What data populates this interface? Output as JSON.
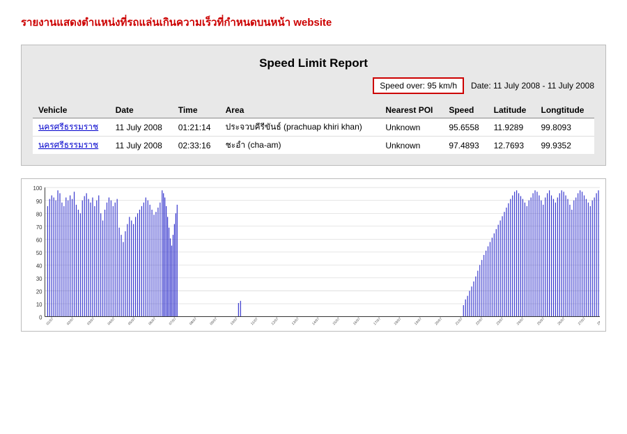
{
  "page": {
    "title": "รายงานแสดงตำแหน่งที่รถแล่นเกินความเร็วที่กำหนดบนหน้า website"
  },
  "report": {
    "title": "Speed Limit Report",
    "speed_over_label": "Speed over: 95 km/h",
    "date_label": "Date: 11 July 2008 - 11 July 2008",
    "table": {
      "headers": [
        "Vehicle",
        "Date",
        "Time",
        "Area",
        "Nearest POI",
        "Speed",
        "Latitude",
        "Longtitude"
      ],
      "rows": [
        {
          "vehicle": "นครศรีธรรมราช",
          "date": "11 July 2008",
          "time": "01:21:14",
          "area": "ประจวบคีรีขันธ์ (prachuap khiri khan)",
          "nearest_poi": "Unknown",
          "speed": "95.6558",
          "latitude": "11.9289",
          "longitude": "99.8093"
        },
        {
          "vehicle": "นครศรีธรรมราช",
          "date": "11 July 2008",
          "time": "02:33:16",
          "area": "ชะอำ (cha-am)",
          "nearest_poi": "Unknown",
          "speed": "97.4893",
          "latitude": "12.7693",
          "longitude": "99.9352"
        }
      ]
    }
  },
  "chart": {
    "y_labels": [
      "100",
      "90",
      "80",
      "70",
      "60",
      "50",
      "40",
      "30",
      "20",
      "10",
      "0"
    ]
  }
}
